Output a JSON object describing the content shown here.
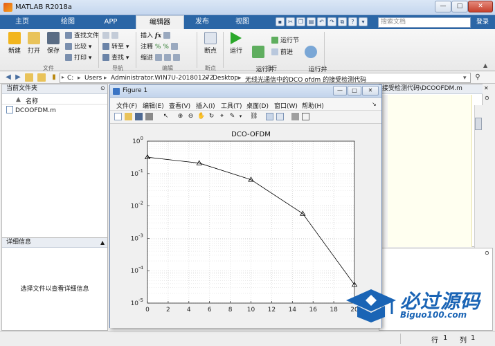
{
  "window": {
    "title": "MATLAB R2018a",
    "minimize_label": "—",
    "maximize_label": "□",
    "close_label": "✕"
  },
  "ribbon_tabs": [
    "主页",
    "绘图",
    "APP",
    "编辑器",
    "发布",
    "视图"
  ],
  "search": {
    "placeholder": "搜索文档"
  },
  "help_label": "登录",
  "ribbon": {
    "file_group": {
      "new": "新建",
      "open": "打开",
      "save": "保存",
      "find_files": "查找文件",
      "compare": "比较",
      "print": "打印",
      "label": "文件"
    },
    "nav_group": {
      "goto": "转至",
      "find": "查找",
      "label": "导航"
    },
    "edit_group": {
      "insert": "插入",
      "comment": "注释",
      "indent": "缩进",
      "label": "编辑"
    },
    "breakpoint_group": {
      "breakpoints": "断点",
      "label": "断点"
    },
    "run_group": {
      "run": "运行",
      "run_advance": "运行并\n前进",
      "run_section": "运行节",
      "advance": "前进",
      "run_time": "运行并\n计时",
      "label": "运行"
    }
  },
  "address": {
    "crumbs": [
      "C:",
      "Users",
      "Administrator.WIN7U-20180127Z",
      "Desktop",
      "无线光通信中的DCO ofdm 的接受检测代码"
    ]
  },
  "folder_panel": {
    "title": "当前文件夹",
    "name_header": "名称",
    "files": [
      "DCOOFDM.m"
    ]
  },
  "detail_panel": {
    "title": "详细信息",
    "message": "选择文件以查看详细信息"
  },
  "editor": {
    "tab_label": "接受检测代码\\DCOOFDM.m"
  },
  "statusbar": {
    "row_label": "行",
    "row": "1",
    "col_label": "列",
    "col": "1"
  },
  "figure": {
    "title": "Figure 1",
    "menu": [
      "文件(F)",
      "编辑(E)",
      "查看(V)",
      "插入(I)",
      "工具(T)",
      "桌面(D)",
      "窗口(W)",
      "帮助(H)"
    ]
  },
  "chart_data": {
    "type": "line",
    "title": "DCO-OFDM",
    "xlabel": "",
    "ylabel": "",
    "x": [
      0,
      5,
      10,
      15,
      20
    ],
    "series": [
      {
        "values": [
          0.32,
          0.21,
          0.065,
          0.0058,
          3.7e-05
        ],
        "marker": "triangle",
        "color": "#000000"
      }
    ],
    "xlim": [
      0,
      20
    ],
    "ylim": [
      1e-05,
      1
    ],
    "yscale": "log",
    "xticks": [
      "0",
      "2",
      "4",
      "6",
      "8",
      "10",
      "12",
      "14",
      "16",
      "18",
      "20"
    ],
    "yticks": [
      "10^0",
      "10^-1",
      "10^-2",
      "10^-3",
      "10^-4",
      "10^-5"
    ],
    "grid": true
  },
  "logo": {
    "cn": "必过源码",
    "en": "Biguo100.com",
    "color": "#1a64b5"
  }
}
